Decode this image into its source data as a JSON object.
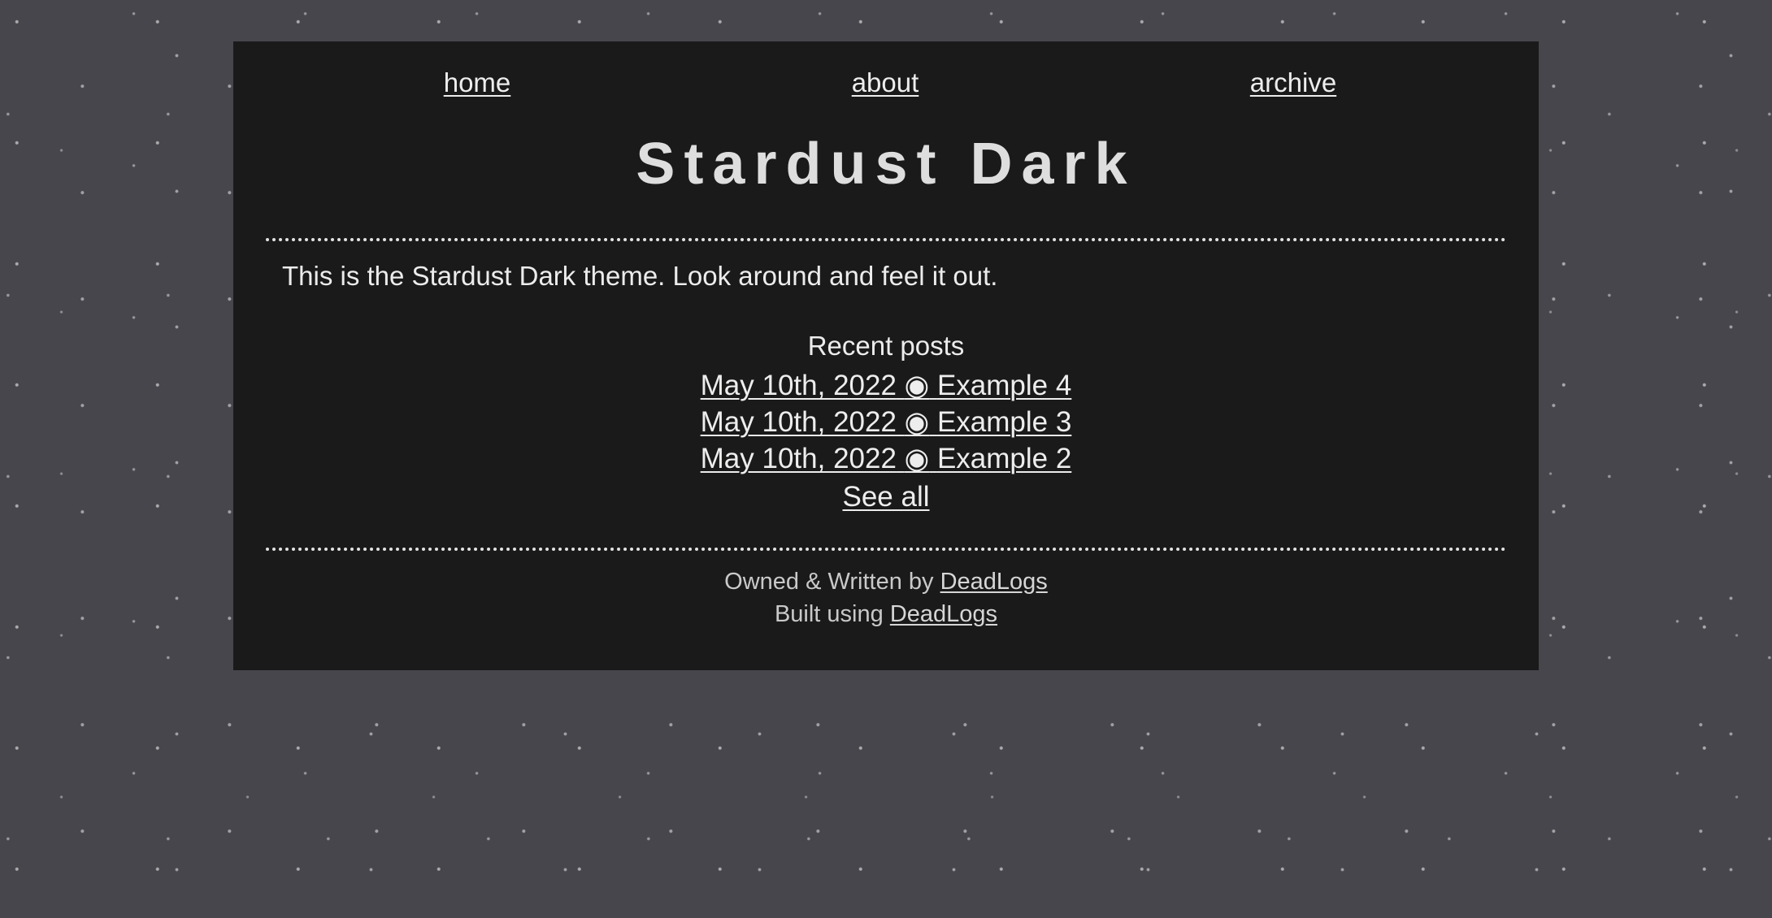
{
  "page": {
    "background_color": "#46464c",
    "panel_color": "#1a1a1b",
    "text_color": "#e6e6e6"
  },
  "nav": {
    "items": [
      {
        "label": "home"
      },
      {
        "label": "about"
      },
      {
        "label": "archive"
      }
    ]
  },
  "header": {
    "title": "Stardust Dark"
  },
  "main": {
    "intro": "This is the Stardust Dark theme. Look around and feel it out.",
    "recent_posts": {
      "heading": "Recent posts",
      "posts": [
        {
          "date": "May 10th, 2022",
          "separator": "◉",
          "title": "Example 4"
        },
        {
          "date": "May 10th, 2022",
          "separator": "◉",
          "title": "Example 3"
        },
        {
          "date": "May 10th, 2022",
          "separator": "◉",
          "title": "Example 2"
        }
      ],
      "see_all_label": "See all"
    }
  },
  "footer": {
    "owned_prefix": "Owned & Written by",
    "owner_link": "DeadLogs",
    "built_prefix": "Built using",
    "built_link": "DeadLogs"
  }
}
